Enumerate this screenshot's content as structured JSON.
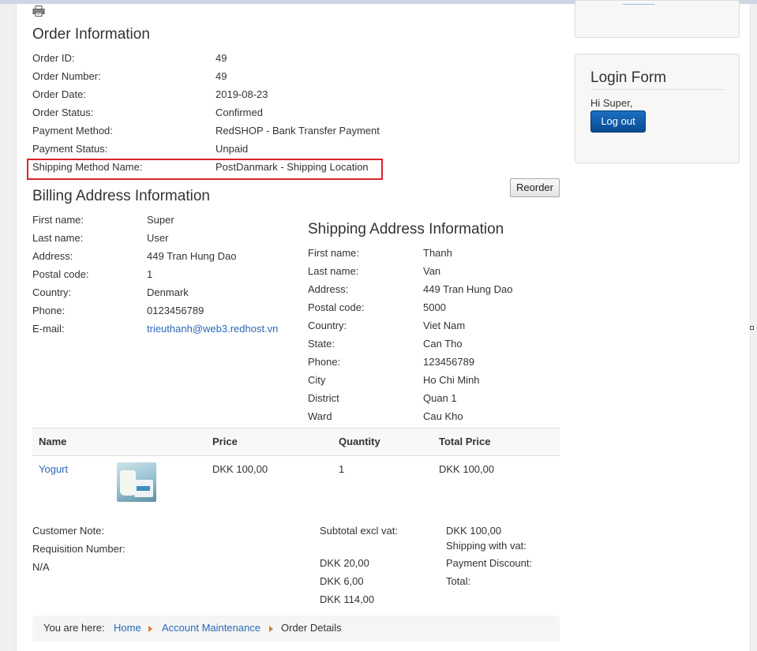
{
  "order_info": {
    "title": "Order Information",
    "rows": [
      {
        "label": "Order ID:",
        "value": "49"
      },
      {
        "label": "Order Number:",
        "value": "49"
      },
      {
        "label": "Order Date:",
        "value": "2019-08-23"
      },
      {
        "label": "Order Status:",
        "value": "Confirmed"
      },
      {
        "label": "Payment Method:",
        "value": "RedSHOP - Bank Transfer Payment"
      },
      {
        "label": "Payment Status:",
        "value": "Unpaid"
      },
      {
        "label": "Shipping Method Name:",
        "value": "PostDanmark - Shipping Location"
      }
    ],
    "reorder_label": "Reorder"
  },
  "billing": {
    "title": "Billing Address Information",
    "rows": [
      {
        "label": "First name:",
        "value": "Super"
      },
      {
        "label": "Last name:",
        "value": "User"
      },
      {
        "label": "Address:",
        "value": "449 Tran Hung Dao"
      },
      {
        "label": "Postal code:",
        "value": "1"
      },
      {
        "label": "Country:",
        "value": "Denmark"
      },
      {
        "label": "Phone:",
        "value": "0123456789"
      },
      {
        "label": "E-mail:",
        "value": "trieuthanh@web3.redhost.vn"
      }
    ]
  },
  "shipping": {
    "title": "Shipping Address Information",
    "rows": [
      {
        "label": "First name:",
        "value": "Thanh"
      },
      {
        "label": "Last name:",
        "value": "Van"
      },
      {
        "label": "Address:",
        "value": "449 Tran Hung Dao"
      },
      {
        "label": "Postal code:",
        "value": "5000"
      },
      {
        "label": "Country:",
        "value": "Viet Nam"
      },
      {
        "label": "State:",
        "value": "Can Tho"
      },
      {
        "label": "Phone:",
        "value": "123456789"
      },
      {
        "label": "City",
        "value": "Ho Chi Minh"
      },
      {
        "label": "District",
        "value": "Quan 1"
      },
      {
        "label": "Ward",
        "value": "Cau Kho"
      }
    ]
  },
  "items_table": {
    "headers": {
      "name": "Name",
      "price": "Price",
      "quantity": "Quantity",
      "total": "Total Price"
    },
    "rows": [
      {
        "name": "Yogurt",
        "price": "DKK 100,00",
        "quantity": "1",
        "total": "DKK 100,00"
      }
    ]
  },
  "notes": {
    "customer_note_label": "Customer Note:",
    "requisition_label": "Requisition Number:",
    "requisition_value": "N/A"
  },
  "totals": {
    "subtotal_label": "Subtotal excl vat:",
    "subtotal_value": "DKK 100,00",
    "shipping_label": "Shipping with vat:",
    "shipping_value": "DKK 20,00",
    "discount_label": "Payment Discount:",
    "discount_value": "DKK 6,00",
    "total_label": "Total:",
    "total_value": "DKK 114,00"
  },
  "breadcrumb": {
    "prefix": "You are here:",
    "items": [
      "Home",
      "Account Maintenance",
      "Order Details"
    ]
  },
  "login_module": {
    "title": "Login Form",
    "greeting": "Hi Super,",
    "logout_label": "Log out"
  },
  "colors": {
    "link": "#2a69b8",
    "highlight_border": "#d9232e",
    "logout_button": "#0a4a92",
    "breadcrumb_separator": "#e07a2f"
  }
}
